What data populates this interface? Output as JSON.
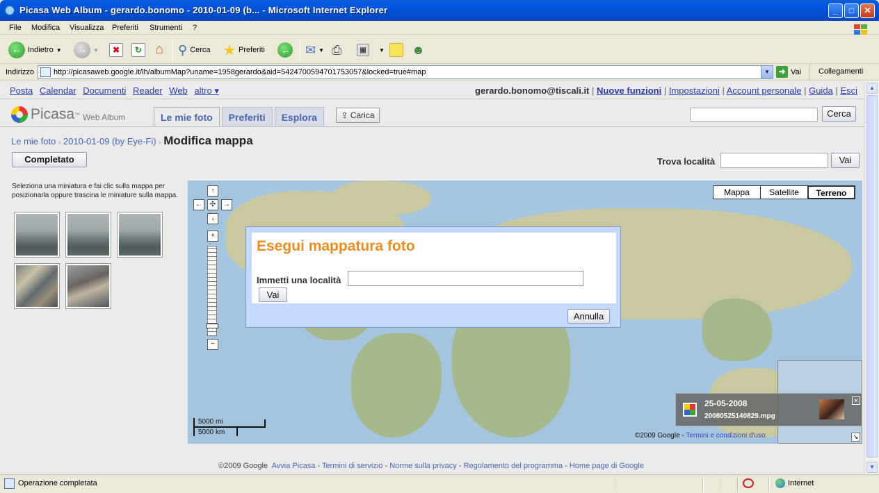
{
  "window": {
    "title": "Picasa Web Album - gerardo.bonomo - 2010-01-09 (b... - Microsoft Internet Explorer",
    "minimize": "_",
    "maximize": "□",
    "close": "✕"
  },
  "menu": [
    "File",
    "Modifica",
    "Visualizza",
    "Preferiti",
    "Strumenti",
    "?"
  ],
  "toolbar": {
    "back_label": "Indietro",
    "search_label": "Cerca",
    "favorites_label": "Preferiti",
    "stop": "✖",
    "refresh": "↻",
    "home": "⌂"
  },
  "address": {
    "label": "Indirizzo",
    "url": "http://picasaweb.google.it/lh/albumMap?uname=1958gerardo&aid=5424700594701753057&locked=true#map",
    "go_label": "Vai",
    "links_label": "Collegamenti"
  },
  "google_bar": {
    "links": [
      "Posta",
      "Calendar",
      "Documenti",
      "Reader",
      "Web"
    ],
    "more": "altro ▾",
    "user": "gerardo.bonomo@tiscali.it",
    "account_links": [
      "Nuove funzioni",
      "Impostazioni",
      "Account personale",
      "Guida",
      "Esci"
    ],
    "new_features": "Nuove funzioni",
    "settings": "Impostazioni",
    "account": "Account personale",
    "help": "Guida",
    "logout": "Esci",
    "separator": "|"
  },
  "picasa": {
    "logo_text": "Picasa",
    "logo_tm": "™",
    "logo_sub": "Web Album",
    "tabs": [
      "Le mie foto",
      "Preferiti",
      "Esplora"
    ],
    "upload_label": "⇪ Carica",
    "search_button": "Cerca",
    "search_value": ""
  },
  "breadcrumb": {
    "root": "Le mie foto",
    "album": "2010-01-09 (by Eye-Fi)",
    "current": "Modifica mappa",
    "separator": "›"
  },
  "edit_map": {
    "done_button": "Completato",
    "find_label": "Trova località",
    "find_value": "",
    "find_button": "Vai",
    "instructions": "Seleziona una miniatura e fai clic sulla mappa per posizionarla oppure trascina le miniature sulla mappa."
  },
  "map": {
    "types": [
      "Mappa",
      "Satellite",
      "Terreno"
    ],
    "selected_type": "Terreno",
    "scale_mi": "5000 mi",
    "scale_km": "5000 km",
    "copyright": "©2009 Google -",
    "terms_link": "Termini e condizioni d'uso",
    "pan_up": "↑",
    "pan_down": "↓",
    "pan_left": "←",
    "pan_right": "→",
    "center": "✣",
    "zoom_in": "+",
    "zoom_out": "−",
    "overview_close": "↘",
    "zoom_level_fraction": 0.1
  },
  "dialog": {
    "title": "Esegui mappatura foto",
    "location_label": "Immetti una località",
    "location_value": "",
    "go_button": "Vai",
    "cancel_button": "Annulla"
  },
  "photo_info": {
    "date": "25-05-2008",
    "filename": "20080525140829.mpg",
    "close": "✕"
  },
  "footer": {
    "copyright": "©2009 Google",
    "links": [
      "Avvia Picasa",
      "Termini di servizio",
      "Norme sulla privacy",
      "Regolamento del programma",
      "Home page di Google"
    ],
    "separator": "-"
  },
  "status": {
    "text": "Operazione completata",
    "zone": "Internet"
  },
  "colors": {
    "dialog_title": "#ef8c1c",
    "link": "#4665b5",
    "title_bar": "#0358e0"
  }
}
